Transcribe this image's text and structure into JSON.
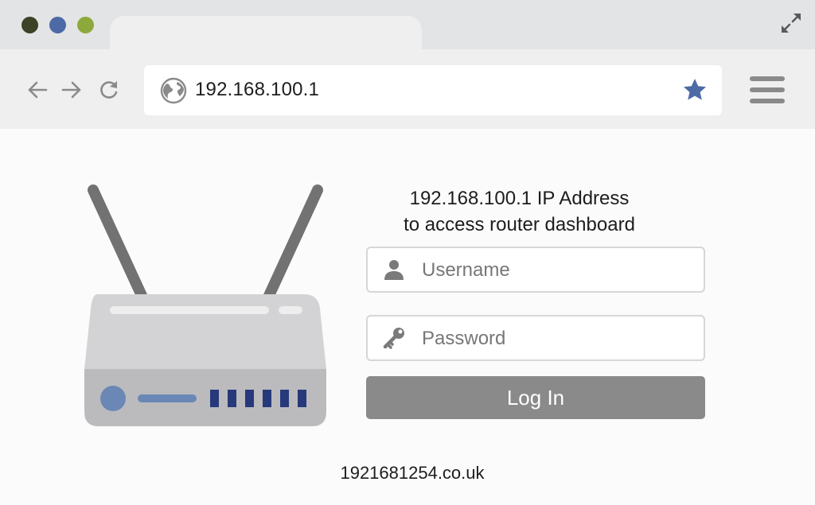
{
  "window": {
    "controls": [
      "close",
      "minimize",
      "maximize"
    ],
    "control_colors": [
      "#3b4226",
      "#4c6aa6",
      "#8ea93b"
    ],
    "expand_icon": "expand-arrows-icon"
  },
  "toolbar": {
    "back_icon": "arrow-left-icon",
    "forward_icon": "arrow-right-icon",
    "reload_icon": "reload-icon",
    "menu_icon": "hamburger-menu-icon"
  },
  "address_bar": {
    "icon": "globe-icon",
    "url": "192.168.100.1",
    "bookmark_icon": "star-icon",
    "bookmark_color": "#4c6aa6"
  },
  "hero": {
    "illustration": "router-icon",
    "title_line1": "192.168.100.1 IP Address",
    "title_line2": "to access router dashboard"
  },
  "login_form": {
    "username_icon": "user-icon",
    "username_placeholder": "Username",
    "password_icon": "key-icon",
    "password_placeholder": "Password",
    "submit_label": "Log In",
    "submit_color": "#8a8a8a"
  },
  "footer": {
    "site": "1921681254.co.uk"
  }
}
